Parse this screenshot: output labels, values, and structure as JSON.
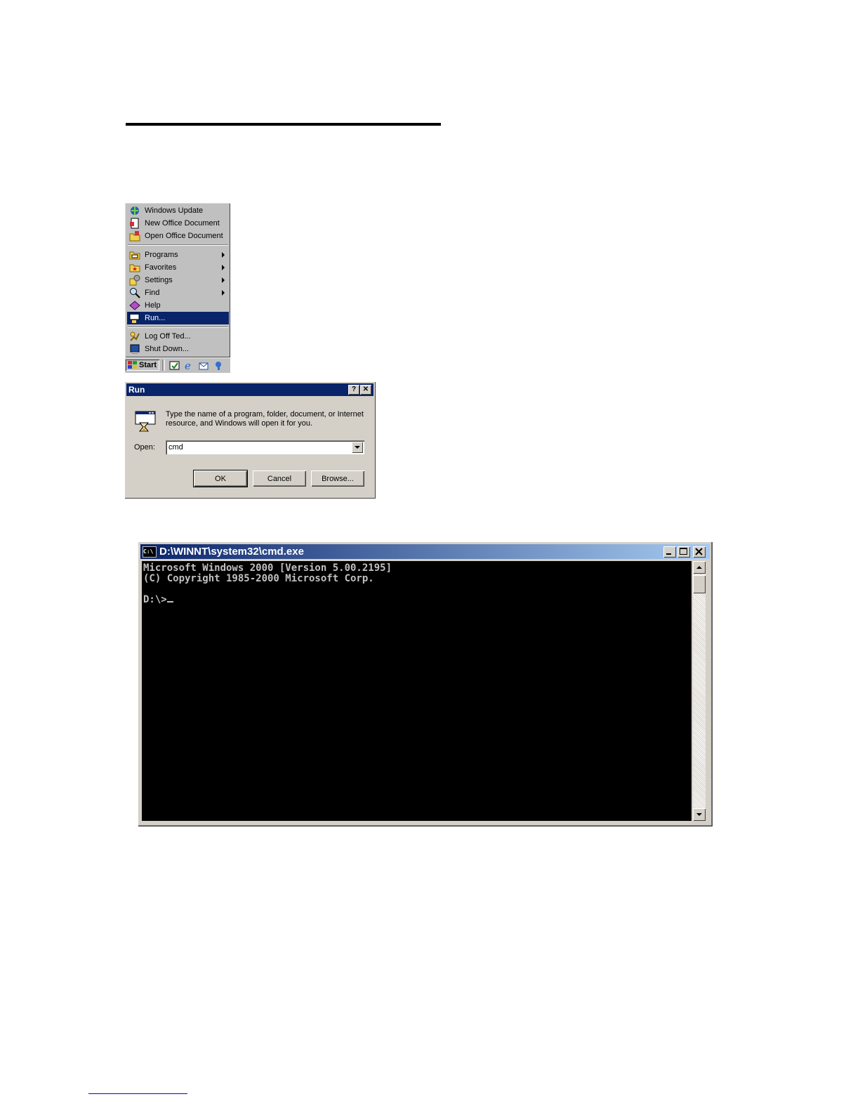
{
  "start_menu": {
    "top_items": [
      {
        "label": "Windows Update",
        "icon": "windows-update-icon"
      },
      {
        "label": "New Office Document",
        "icon": "new-office-document-icon"
      },
      {
        "label": "Open Office Document",
        "icon": "open-office-document-icon"
      }
    ],
    "main_items": [
      {
        "label": "Programs",
        "icon": "programs-folder-icon",
        "submenu": true
      },
      {
        "label": "Favorites",
        "icon": "favorites-folder-icon",
        "submenu": true
      },
      {
        "label": "Settings",
        "icon": "settings-icon",
        "submenu": true
      },
      {
        "label": "Find",
        "icon": "find-icon",
        "submenu": true
      },
      {
        "label": "Help",
        "icon": "help-book-icon",
        "submenu": false
      },
      {
        "label": "Run...",
        "icon": "run-icon",
        "submenu": false,
        "selected": true
      }
    ],
    "bottom_items": [
      {
        "label": "Log Off Ted...",
        "icon": "log-off-icon"
      },
      {
        "label": "Shut Down...",
        "icon": "shut-down-icon"
      }
    ]
  },
  "taskbar": {
    "start_label": "Start",
    "quick_launch": [
      "show-desktop-icon",
      "internet-explorer-icon",
      "outlook-express-icon",
      "media-player-icon"
    ]
  },
  "run_dialog": {
    "title": "Run",
    "help_button": "?",
    "close_button": "✕",
    "description": "Type the name of a program, folder, document, or Internet resource, and Windows will open it for you.",
    "open_label": "Open:",
    "open_value": "cmd",
    "ok_label": "OK",
    "cancel_label": "Cancel",
    "browse_label": "Browse..."
  },
  "cmd_window": {
    "title": "D:\\WINNT\\system32\\cmd.exe",
    "icon_text": "C:\\",
    "lines": [
      "Microsoft Windows 2000 [Version 5.00.2195]",
      "(C) Copyright 1985-2000 Microsoft Corp.",
      "",
      "D:\\>"
    ]
  },
  "colors": {
    "title_active": "#0a246a",
    "title_gradient_end": "#a6caf0",
    "face": "#d4d0c8",
    "console_bg": "#000000",
    "console_text": "#c0c0c0"
  }
}
